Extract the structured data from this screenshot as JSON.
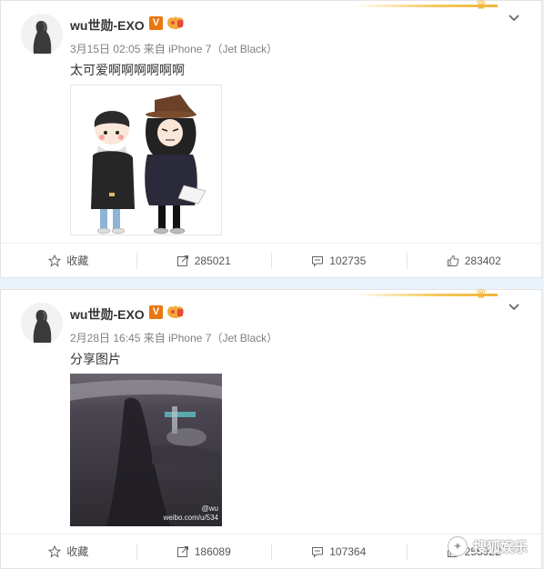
{
  "posts": [
    {
      "username": "wu世勋-EXO",
      "verified_badge": "V",
      "timestamp": "3月15日 02:05",
      "source": "来自 iPhone 7（Jet Black）",
      "text": "太可爱啊啊啊啊啊啊",
      "image_desc": "cartoon-couple-illustration",
      "actions": {
        "favorite_label": "收藏",
        "repost_count": "285021",
        "comment_count": "102735",
        "like_count": "283402"
      }
    },
    {
      "username": "wu世勋-EXO",
      "verified_badge": "V",
      "timestamp": "2月28日 16:45",
      "source": "来自 iPhone 7（Jet Black）",
      "text": "分享图片",
      "image_desc": "dark-photo",
      "image_watermark_line1": "@wu",
      "image_watermark_line2": "weibo.com/u/534",
      "actions": {
        "favorite_label": "收藏",
        "repost_count": "186089",
        "comment_count": "107364",
        "like_count": "255922"
      }
    }
  ],
  "watermark": {
    "text": "搜狐娱乐"
  },
  "colors": {
    "background": "#eaf3fb",
    "gold": "#f0b53a",
    "verified": "#e9770f"
  }
}
